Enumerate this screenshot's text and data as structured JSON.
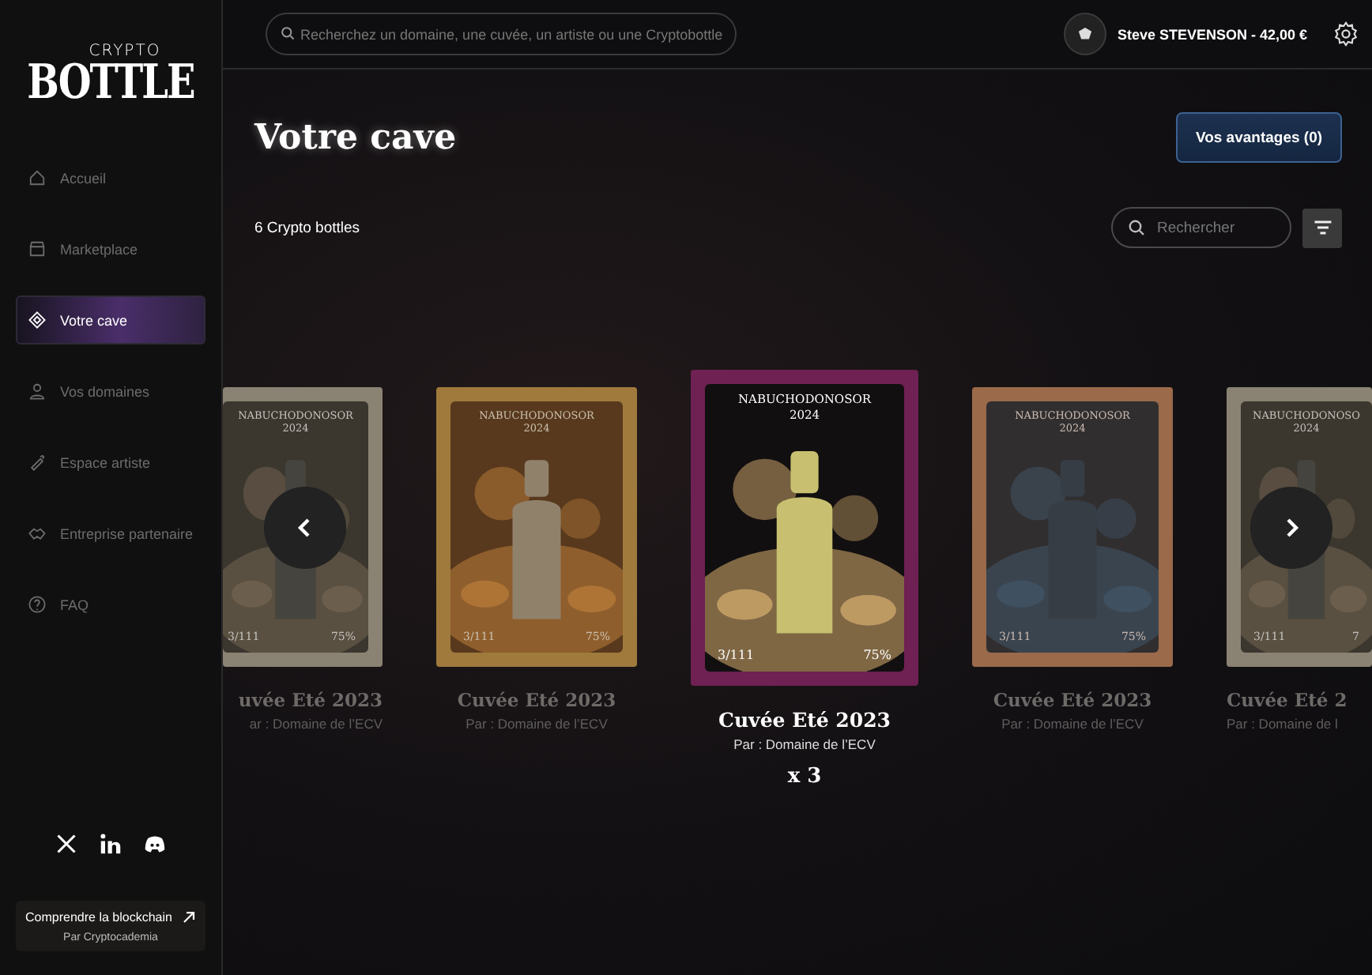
{
  "sidebar": {
    "logo": {
      "top": "CRYPTO",
      "main": "BOTTLE"
    },
    "items": [
      {
        "label": "Accueil",
        "selected": false
      },
      {
        "label": "Marketplace",
        "selected": false
      },
      {
        "label": "Votre cave",
        "selected": true
      },
      {
        "label": "Vos domaines",
        "selected": false
      },
      {
        "label": "Espace artiste",
        "selected": false
      },
      {
        "label": "Entreprise partenaire",
        "selected": false
      },
      {
        "label": "FAQ",
        "selected": false
      }
    ],
    "promo": {
      "title": "Comprendre la blockchain",
      "subtitle": "Par Cryptocademia"
    }
  },
  "topbar": {
    "search": {
      "placeholder": "Recherchez un domaine, une cuvée, un artiste ou une Cryptobottle"
    },
    "user": "Steve STEVENSON - 42,00 €"
  },
  "page": {
    "title": "Votre cave",
    "button": "Vos avantages (0)",
    "count": "6 Crypto bottles",
    "search": {
      "placeholder": "Rechercher"
    }
  },
  "cards": [
    {
      "kind": "cut-left",
      "selected": false,
      "color": "#8a8272",
      "format": "NABUCHODONOSOR",
      "year": "2024",
      "edition": "3/111",
      "percent": "75%",
      "title": "uvée Eté 2023",
      "byline": "ar : Domaine de l’ECV"
    },
    {
      "kind": "whole",
      "selected": false,
      "color": "#a07a3c",
      "format": "NABUCHODONOSOR",
      "year": "2024",
      "edition": "3/111",
      "percent": "75%",
      "title": "Cuvée Eté 2023",
      "byline": "Par : Domaine de l’ECV"
    },
    {
      "kind": "whole",
      "selected": true,
      "color": "#6e2152",
      "format": "NABUCHODONOSOR",
      "year": "2024",
      "edition": "3/111",
      "percent": "75%",
      "title": "Cuvée Eté 2023",
      "byline": "Par : Domaine de l’ECV",
      "count": "x 3"
    },
    {
      "kind": "whole",
      "selected": false,
      "color": "#9a6a4a",
      "format": "NABUCHODONOSOR",
      "year": "2024",
      "edition": "3/111",
      "percent": "75%",
      "title": "Cuvée Eté 2023",
      "byline": "Par : Domaine de l’ECV"
    },
    {
      "kind": "cut-right",
      "selected": false,
      "color": "#8a8272",
      "format": "NABUCHODONOSO",
      "year": "2024",
      "edition": "3/111",
      "percent": "7",
      "title": "Cuvée Eté 2",
      "byline": "Par : Domaine de l"
    }
  ]
}
